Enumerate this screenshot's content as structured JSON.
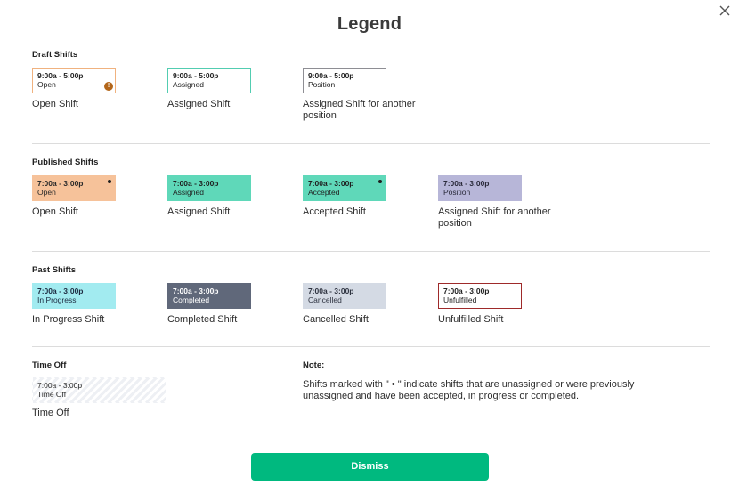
{
  "dialog": {
    "title": "Legend",
    "dismiss_label": "Dismiss"
  },
  "colors": {
    "accent": "#00b97f",
    "open_orange": "#f6c29a",
    "assigned_teal": "#5fd8b9",
    "position_lavender": "#b7b6d8",
    "in_progress_cyan": "#a2ebf0",
    "completed_slate": "#60687a",
    "cancelled_gray": "#d4dae4",
    "unfulfilled_red": "#9e2a2a",
    "warning_brown": "#b3661a"
  },
  "draft": {
    "title": "Draft Shifts",
    "items": [
      {
        "time": "9:00a - 5:00p",
        "label": "Open",
        "caption": "Open Shift"
      },
      {
        "time": "9:00a - 5:00p",
        "label": "Assigned",
        "caption": "Assigned Shift"
      },
      {
        "time": "9:00a - 5:00p",
        "label": "Position",
        "caption": "Assigned Shift for another position"
      }
    ],
    "warning_icon": "!"
  },
  "published": {
    "title": "Published Shifts",
    "items": [
      {
        "time": "7:00a - 3:00p",
        "label": "Open",
        "caption": "Open Shift"
      },
      {
        "time": "7:00a - 3:00p",
        "label": "Assigned",
        "caption": "Assigned Shift"
      },
      {
        "time": "7:00a - 3:00p",
        "label": "Accepted",
        "caption": "Accepted Shift"
      },
      {
        "time": "7:00a - 3:00p",
        "label": "Position",
        "caption": "Assigned Shift for another position"
      }
    ]
  },
  "past": {
    "title": "Past Shifts",
    "items": [
      {
        "time": "7:00a - 3:00p",
        "label": "In Progress",
        "caption": "In Progress Shift"
      },
      {
        "time": "7:00a - 3:00p",
        "label": "Completed",
        "caption": "Completed Shift"
      },
      {
        "time": "7:00a - 3:00p",
        "label": "Cancelled",
        "caption": "Cancelled Shift"
      },
      {
        "time": "7:00a - 3:00p",
        "label": "Unfulfilled",
        "caption": "Unfulfilled Shift"
      }
    ]
  },
  "time_off": {
    "title": "Time Off",
    "time": "7:00a - 3:00p",
    "label": "Time Off",
    "caption": "Time Off"
  },
  "note": {
    "title": "Note:",
    "text": "Shifts marked with \" • \" indicate shifts that are unassigned or were previously unassigned and have been accepted, in progress or completed."
  }
}
